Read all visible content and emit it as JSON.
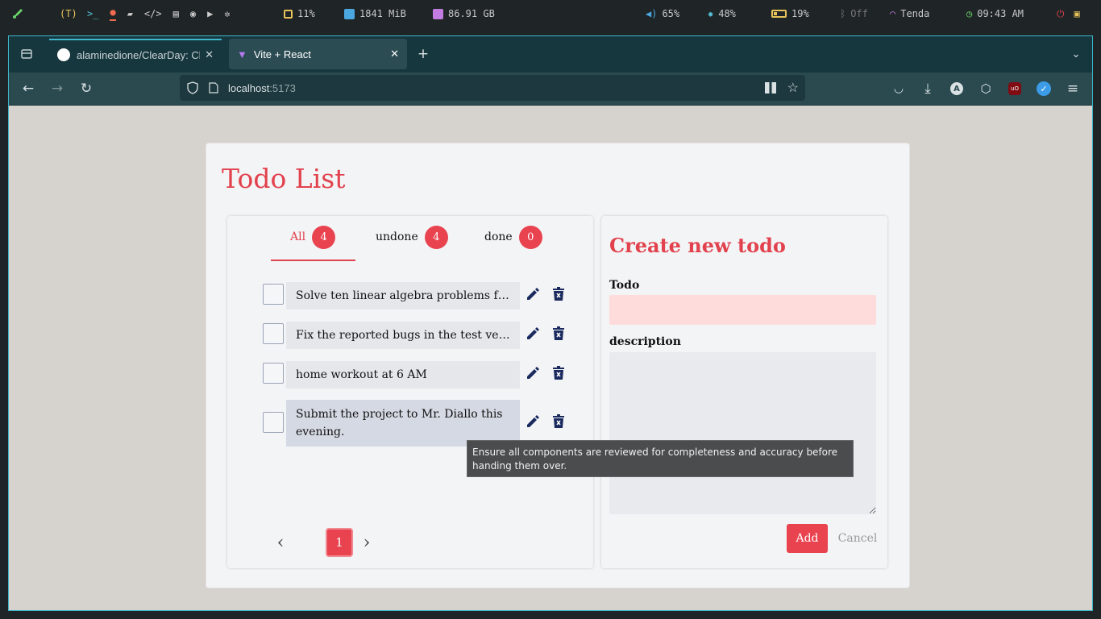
{
  "system_bar": {
    "workspace": "(T)",
    "cpu": "11%",
    "memory": "1841 MiB",
    "disk": "86.91 GB",
    "volume": "65%",
    "brightness": "48%",
    "battery": "19%",
    "bluetooth": "Off",
    "wifi": "Tenda",
    "clock": "09:43 AM"
  },
  "browser": {
    "tabs": [
      {
        "label": "alaminedione/ClearDay: Clear",
        "icon": "github-icon",
        "active": false
      },
      {
        "label": "Vite + React",
        "icon": "vite-icon",
        "active": true
      }
    ],
    "url_host": "localhost",
    "url_port": ":5173"
  },
  "app": {
    "title": "Todo List",
    "filters": [
      {
        "label": "All",
        "count": "4"
      },
      {
        "label": "undone",
        "count": "4"
      },
      {
        "label": "done",
        "count": "0"
      }
    ],
    "todos": [
      {
        "text": "Solve ten linear algebra problems from the textbook"
      },
      {
        "text": "Fix the reported bugs in the test version"
      },
      {
        "text": "home workout at 6 AM"
      },
      {
        "text": "Submit the project to Mr. Diallo this evening."
      }
    ],
    "pagination": {
      "current": "1",
      "prev": "‹",
      "next": "›"
    },
    "form": {
      "heading": "Create new todo",
      "todo_label": "Todo",
      "todo_value": "",
      "description_label": "description",
      "description_value": "",
      "add_label": "Add",
      "cancel_label": "Cancel"
    },
    "tooltip": "Ensure all components are reviewed for completeness and accuracy before handing them over."
  },
  "colors": {
    "accent": "#e2424d",
    "badge": "#e8434f",
    "icon_navy": "#1a2a5e"
  }
}
